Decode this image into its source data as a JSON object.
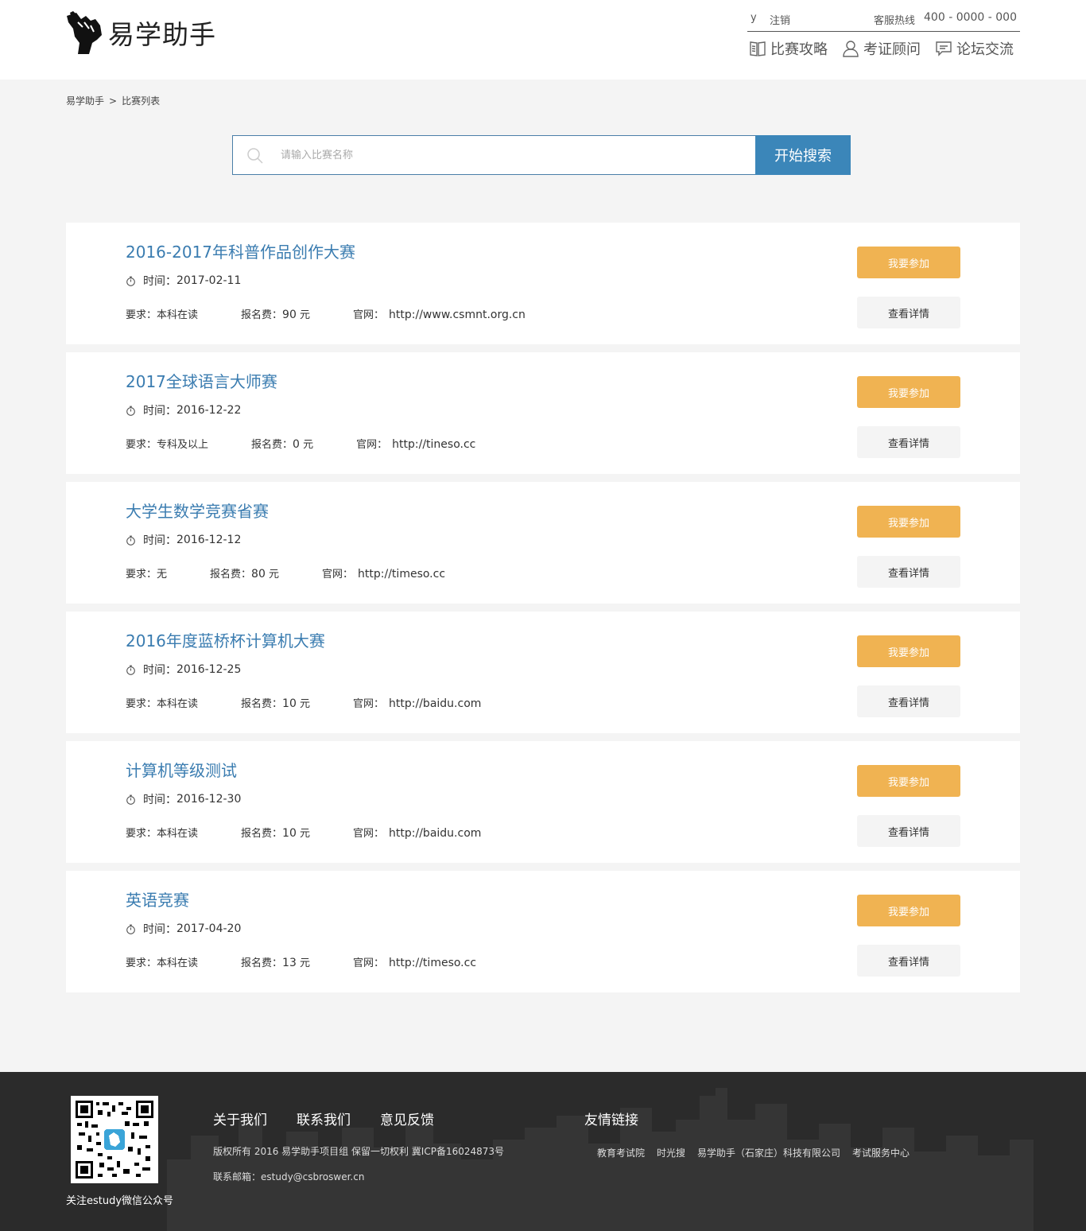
{
  "header": {
    "logo_text": "易学助手",
    "user": "y",
    "logout": "注销",
    "hotline_label": "客服热线",
    "hotline_number": "400 - 0000 - 000",
    "nav": [
      {
        "label": "比赛攻略",
        "icon": "book-icon"
      },
      {
        "label": "考证顾问",
        "icon": "user-icon"
      },
      {
        "label": "论坛交流",
        "icon": "chat-icon"
      }
    ]
  },
  "breadcrumb": {
    "home": "易学助手",
    "separator": ">",
    "current": "比赛列表"
  },
  "search": {
    "placeholder": "请输入比赛名称",
    "button": "开始搜索"
  },
  "labels": {
    "time": "时间：",
    "requirement": "要求：",
    "fee": "报名费：",
    "fee_unit": "元",
    "website": "官网：",
    "join": "我要参加",
    "detail": "查看详情"
  },
  "competitions": [
    {
      "title": "2016-2017年科普作品创作大赛",
      "time": "2017-02-11",
      "requirement": "本科在读",
      "fee": "90",
      "website": "http://www.csmnt.org.cn"
    },
    {
      "title": "2017全球语言大师赛",
      "time": "2016-12-22",
      "requirement": "专科及以上",
      "fee": "0",
      "website": "http://tineso.cc"
    },
    {
      "title": "大学生数学竞赛省赛",
      "time": "2016-12-12",
      "requirement": "无",
      "fee": "80",
      "website": "http://timeso.cc"
    },
    {
      "title": "2016年度蓝桥杯计算机大赛",
      "time": "2016-12-25",
      "requirement": "本科在读",
      "fee": "10",
      "website": "http://baidu.com"
    },
    {
      "title": "计算机等级测试",
      "time": "2016-12-30",
      "requirement": "本科在读",
      "fee": "10",
      "website": "http://baidu.com"
    },
    {
      "title": "英语竞赛",
      "time": "2017-04-20",
      "requirement": "本科在读",
      "fee": "13",
      "website": "http://timeso.cc"
    }
  ],
  "footer": {
    "qr_caption": "关注estudy微信公众号",
    "links": [
      "关于我们",
      "联系我们",
      "意见反馈"
    ],
    "copyright": "版权所有 2016 易学助手项目组 保留一切权利 冀ICP备16024873号",
    "email": "联系邮箱：estudy@csbroswer.cn",
    "friend_title": "友情链接",
    "friend_links": [
      "教育考试院",
      "时光搜",
      "易学助手（石家庄）科技有限公司",
      "考试服务中心"
    ]
  },
  "colors": {
    "accent": "#3b86b9",
    "title": "#3a7cb0",
    "join_button": "#f0b352",
    "footer_bg": "#2b2b2b"
  }
}
